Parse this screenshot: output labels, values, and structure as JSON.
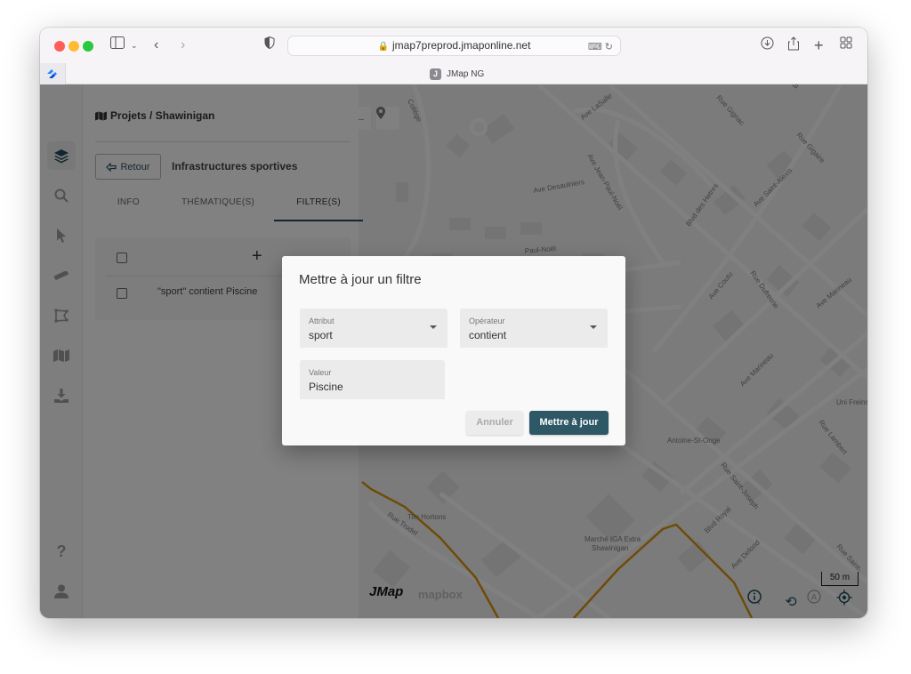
{
  "browser": {
    "url": "jmap7preprod.jmaponline.net",
    "tab_title": "JMap NG",
    "tab_favicon_letter": "J"
  },
  "sidebar": {
    "items": [
      {
        "name": "layers",
        "icon": "layers-icon",
        "active": true
      },
      {
        "name": "search",
        "icon": "search-icon",
        "active": false
      },
      {
        "name": "select",
        "icon": "cursor-icon",
        "active": false
      },
      {
        "name": "measure",
        "icon": "ruler-icon",
        "active": false
      },
      {
        "name": "draw",
        "icon": "polygon-icon",
        "active": false
      },
      {
        "name": "basemaps",
        "icon": "map-icon",
        "active": false
      },
      {
        "name": "export",
        "icon": "download-icon",
        "active": false
      }
    ],
    "bottom_items": [
      {
        "name": "help",
        "icon": "help-icon"
      },
      {
        "name": "user",
        "icon": "user-icon"
      }
    ]
  },
  "panel": {
    "breadcrumb": "Projets / Shawinigan",
    "back_button": "Retour",
    "layer_title": "Infrastructures sportives",
    "tabs": [
      {
        "label": "INFO",
        "active": false
      },
      {
        "label": "THÉMATIQUE(S)",
        "active": false
      },
      {
        "label": "FILTRE(S)",
        "active": true
      }
    ],
    "filters": [
      {
        "label": "\"sport\" contient Piscine",
        "checked": false
      }
    ],
    "add_label": "+"
  },
  "dialog": {
    "title": "Mettre à jour un filtre",
    "attribute": {
      "label": "Attribut",
      "value": "sport"
    },
    "operator": {
      "label": "Opérateur",
      "value": "contient"
    },
    "value": {
      "label": "Valeur",
      "value": "Piscine"
    },
    "cancel_label": "Annuler",
    "submit_label": "Mettre à jour"
  },
  "map": {
    "streets": [
      "Collège",
      "Ave LaSalle",
      "Rue Gignac",
      "Blvd des Hetres",
      "Rue Gigaire",
      "Ave Desaulniers",
      "Ave Jean-Paul-Noël",
      "Ave Saint-Alexis",
      "Paul-Noël",
      "Ave Coutu",
      "Rue Dufresne",
      "Ave Marineau",
      "Uni Freins Enr",
      "Rue Lambert",
      "Antoine-St-Onge",
      "Rue Saint-Joseph",
      "Ave Defond",
      "Blvd Royal",
      "Tim Hortons",
      "Marché IGA Extra Shawinigan",
      "Rue Trudel",
      "Rue Saint-"
    ],
    "scale": "50 m",
    "attribution_jmap": "JMap",
    "attribution_mapbox": "mapbox",
    "route_color": "#d4930e"
  },
  "colors": {
    "accent": "#2e5866",
    "overlay": "rgba(0,0,0,0.48)"
  }
}
